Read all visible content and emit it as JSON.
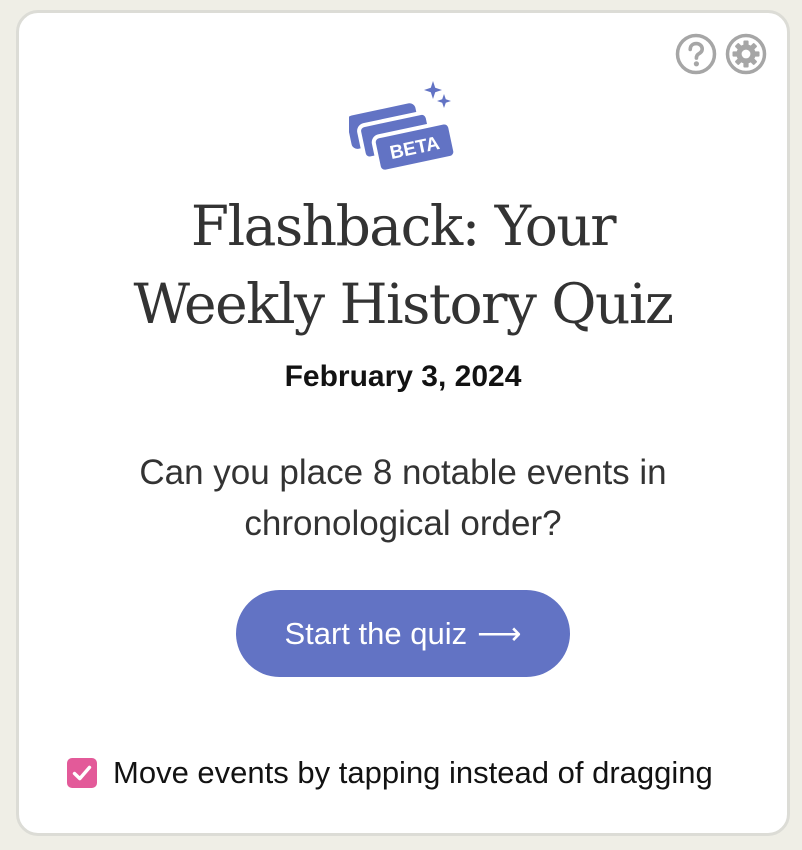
{
  "header": {
    "icons": [
      "help-icon",
      "settings-icon"
    ]
  },
  "logo": {
    "badge_text": "BETA"
  },
  "title": {
    "line1": "Flashback: Your",
    "line2": "Weekly History Quiz"
  },
  "date": "February 3, 2024",
  "prompt": {
    "line1": "Can you place 8 notable events in",
    "line2": "chronological order?"
  },
  "start_button": {
    "label": "Start the quiz",
    "arrow": "⟶"
  },
  "tap_option": {
    "label": "Move events by tapping instead of dragging",
    "checked": true
  },
  "colors": {
    "page_background": "#efeee6",
    "card_background": "#ffffff",
    "accent_blue": "#6273c4",
    "checkbox_pink": "#e35a99",
    "title_text": "#333333",
    "icon_gray": "#a6a6a6"
  }
}
